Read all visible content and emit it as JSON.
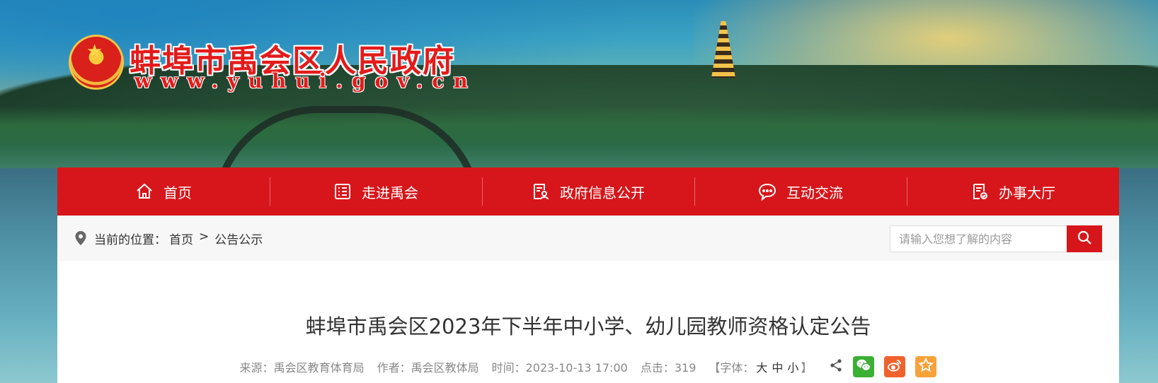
{
  "header": {
    "site_title": "蚌埠市禹会区人民政府",
    "site_url": "www.yuhui.gov.cn"
  },
  "nav": {
    "items": [
      {
        "label": "首页",
        "icon": "home-icon"
      },
      {
        "label": "走进禹会",
        "icon": "list-icon"
      },
      {
        "label": "政府信息公开",
        "icon": "document-user-icon"
      },
      {
        "label": "互动交流",
        "icon": "chat-icon"
      },
      {
        "label": "办事大厅",
        "icon": "checklist-icon"
      }
    ]
  },
  "breadcrumb": {
    "prefix": "当前的位置：",
    "home": "首页",
    "separator": ">",
    "current": "公告公示"
  },
  "search": {
    "placeholder": "请输入您想了解的内容"
  },
  "article": {
    "title": "蚌埠市禹会区2023年下半年中小学、幼儿园教师资格认定公告",
    "source_label": "来源：",
    "source": "禹会区教育体育局",
    "author_label": "作者：",
    "author": "禹会区教体局",
    "time_label": "时间：",
    "time": "2023-10-13 17:00",
    "clicks_label": "点击：",
    "clicks": "319",
    "font_label_open": "【字体：",
    "font_large": "大",
    "font_medium": "中",
    "font_small": "小",
    "font_label_close": "】"
  },
  "colors": {
    "nav_red": "#d7161b",
    "wechat_green": "#3cb034",
    "weibo_orange": "#f0622b",
    "favorite_orange": "#f7a23b"
  }
}
